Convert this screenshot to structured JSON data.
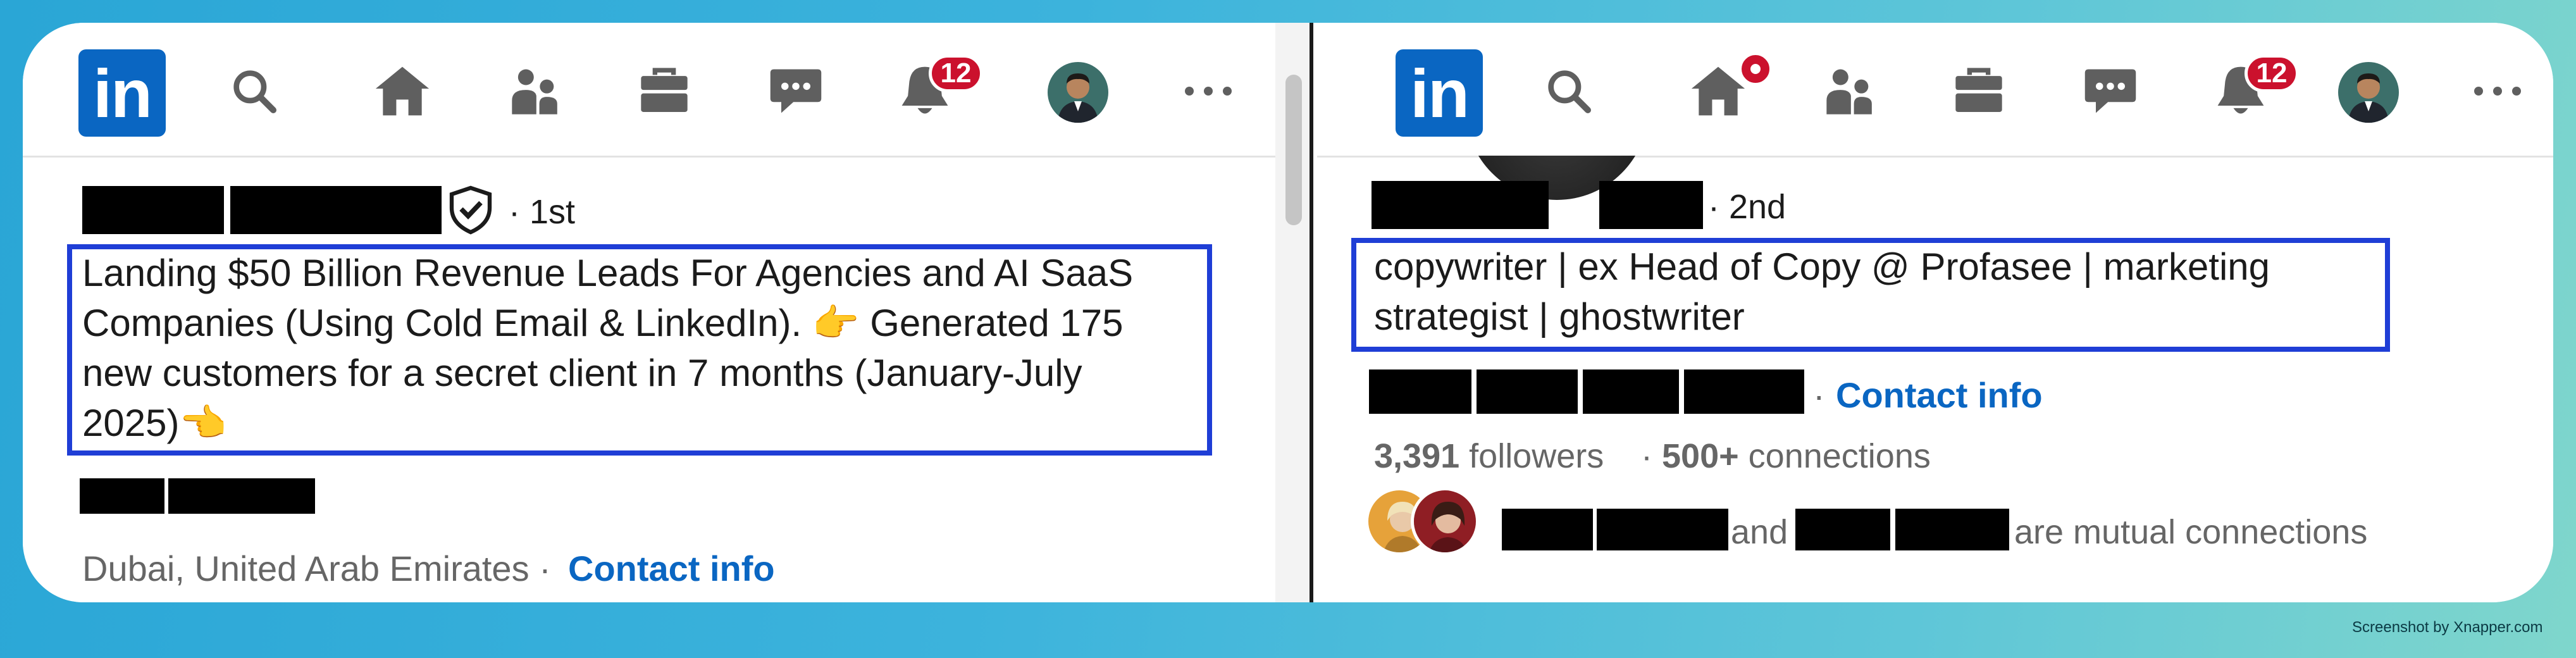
{
  "left_profile": {
    "nav": {
      "logo_text": "in",
      "notifications_count": "12",
      "icons": [
        "linkedin-logo",
        "search-icon",
        "home-icon",
        "my-network-icon",
        "jobs-icon",
        "messaging-icon",
        "notifications-icon",
        "avatar",
        "more-icon"
      ]
    },
    "degree": "· 1st",
    "headline_lines": [
      "Landing $50 Billion Revenue Leads For Agencies and AI SaaS",
      "Companies (Using Cold Email & LinkedIn). 👉 Generated 175",
      "new customers for a secret client in 7 months (January-July",
      "2025)👈"
    ],
    "location": "Dubai, United Arab Emirates ·",
    "contact_info": "Contact info"
  },
  "right_profile": {
    "nav": {
      "logo_text": "in",
      "notifications_count": "12"
    },
    "degree": "· 2nd",
    "headline_lines": [
      "copywriter | ex Head of Copy @ Profasee | marketing",
      "strategist | ghostwriter"
    ],
    "contact_sep": "·",
    "contact_info": "Contact info",
    "followers_count": "3,391",
    "followers_label": "followers",
    "connections_sep": "·",
    "connections_count": "500+",
    "connections_label": "connections",
    "mutual_and": "and",
    "mutual_suffix": "are mutual connections"
  },
  "watermark": "Screenshot by Xnapper.com",
  "colors": {
    "linkedin_blue": "#0a66c2",
    "badge_red": "#cb112d",
    "highlight_box": "#1f3ed6"
  }
}
